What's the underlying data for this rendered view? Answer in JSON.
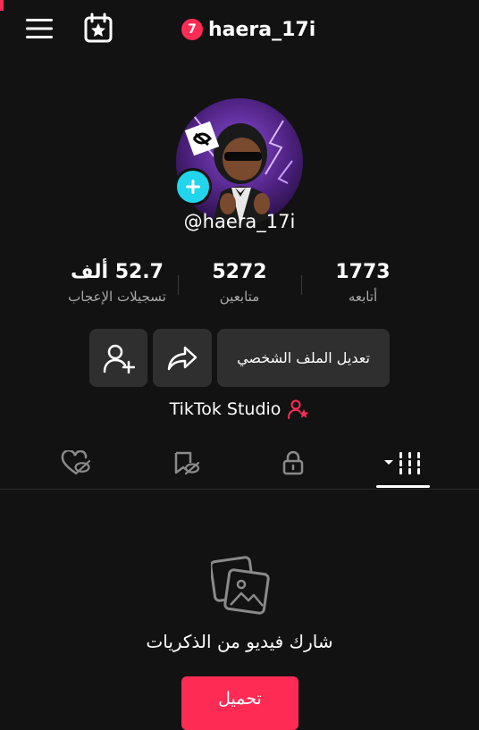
{
  "header": {
    "notification_count": "7",
    "username": "haera_17i"
  },
  "profile": {
    "handle": "@haera_17i"
  },
  "stats": {
    "following": {
      "value": "1773",
      "label": "أتابعه"
    },
    "followers": {
      "value": "5272",
      "label": "متابعين"
    },
    "likes": {
      "value": "52.7 ألف",
      "label": "تسجيلات الإعجاب"
    }
  },
  "actions": {
    "edit_profile_label": "تعديل الملف الشخصي"
  },
  "studio": {
    "label": "TikTok Studio"
  },
  "tabs": [
    {
      "name": "videos",
      "icon": "grid-icon",
      "selected": true
    },
    {
      "name": "private",
      "icon": "lock-icon",
      "selected": false
    },
    {
      "name": "reposts",
      "icon": "repost-icon",
      "selected": false
    },
    {
      "name": "liked",
      "icon": "heart-hidden-icon",
      "selected": false
    }
  ],
  "empty_state": {
    "message": "شارك فيديو من الذكريات",
    "upload_label": "تحميل"
  },
  "colors": {
    "accent": "#fe2c55",
    "add_badge": "#20d5ec",
    "background": "#121212",
    "button_bg": "#2f2f2f",
    "secondary_text": "#a8a8a8"
  }
}
